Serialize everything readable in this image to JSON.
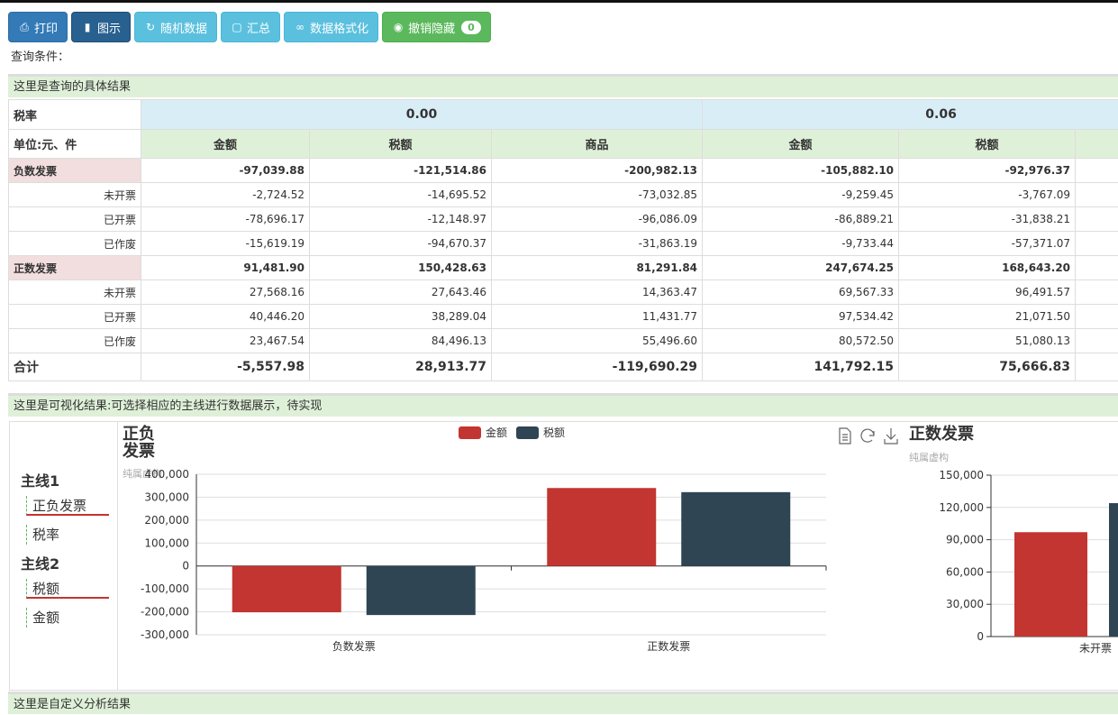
{
  "toolbar": {
    "print": "打印",
    "chart": "图示",
    "random": "随机数据",
    "summary": "汇总",
    "format": "数据格式化",
    "unhide": "撤销隐藏",
    "unhide_count": "0"
  },
  "query_label": "查询条件：",
  "result_header": "这里是查询的具体结果",
  "table": {
    "rate_label": "税率",
    "unit_label": "单位:元、件",
    "rates": [
      "0.00",
      "0.06"
    ],
    "columns": [
      "金额",
      "税额",
      "商品",
      "金额",
      "税额"
    ],
    "rows": [
      {
        "label": "负数发票",
        "group": true,
        "values": [
          "-97,039.88",
          "-121,514.86",
          "-200,982.13",
          "-105,882.10",
          "-92,976.37"
        ]
      },
      {
        "label": "未开票",
        "group": false,
        "values": [
          "-2,724.52",
          "-14,695.52",
          "-73,032.85",
          "-9,259.45",
          "-3,767.09"
        ]
      },
      {
        "label": "已开票",
        "group": false,
        "values": [
          "-78,696.17",
          "-12,148.97",
          "-96,086.09",
          "-86,889.21",
          "-31,838.21"
        ]
      },
      {
        "label": "已作废",
        "group": false,
        "values": [
          "-15,619.19",
          "-94,670.37",
          "-31,863.19",
          "-9,733.44",
          "-57,371.07"
        ]
      },
      {
        "label": "正数发票",
        "group": true,
        "values": [
          "91,481.90",
          "150,428.63",
          "81,291.84",
          "247,674.25",
          "168,643.20"
        ]
      },
      {
        "label": "未开票",
        "group": false,
        "values": [
          "27,568.16",
          "27,643.46",
          "14,363.47",
          "69,567.33",
          "96,491.57"
        ]
      },
      {
        "label": "已开票",
        "group": false,
        "values": [
          "40,446.20",
          "38,289.04",
          "11,431.77",
          "97,534.42",
          "21,071.50"
        ]
      },
      {
        "label": "已作废",
        "group": false,
        "values": [
          "23,467.54",
          "84,496.13",
          "55,496.60",
          "80,572.50",
          "51,080.13"
        ]
      }
    ],
    "total": {
      "label": "合计",
      "values": [
        "-5,557.98",
        "28,913.77",
        "-119,690.29",
        "141,792.15",
        "75,666.83"
      ]
    }
  },
  "vis_header": "这里是可视化结果:可选择相应的主线进行数据展示，待实现",
  "sidebar": {
    "line1": "主线1",
    "line1_items": [
      "正负发票",
      "税率"
    ],
    "line2": "主线2",
    "line2_items": [
      "税额",
      "金额"
    ]
  },
  "colors": {
    "amount": "#c23531",
    "tax": "#2f4554"
  },
  "chart_data": [
    {
      "type": "bar",
      "title": "正负发票",
      "subtitle": "纯属虚构",
      "categories": [
        "负数发票",
        "正数发票"
      ],
      "series": [
        {
          "name": "金额",
          "values": [
            -202000,
            340000
          ]
        },
        {
          "name": "税额",
          "values": [
            -214000,
            322000
          ]
        }
      ],
      "ylim": [
        -300000,
        400000
      ],
      "yticks": [
        "-300,000",
        "-200,000",
        "-100,000",
        "0",
        "100,000",
        "200,000",
        "300,000",
        "400,000"
      ],
      "legend": "top-center",
      "toolbox": [
        "data-view-icon",
        "restore-icon",
        "save-icon"
      ],
      "grid": true
    },
    {
      "type": "bar",
      "title": "正数发票",
      "subtitle": "纯属虚构",
      "categories": [
        "未开票"
      ],
      "series": [
        {
          "name": "金额",
          "values": [
            97000
          ]
        },
        {
          "name": "税额",
          "values": [
            124000
          ]
        }
      ],
      "ylim": [
        0,
        150000
      ],
      "yticks": [
        "0",
        "30,000",
        "60,000",
        "90,000",
        "120,000",
        "150,000"
      ],
      "grid": true
    }
  ],
  "custom_header": "这里是自定义分析结果"
}
